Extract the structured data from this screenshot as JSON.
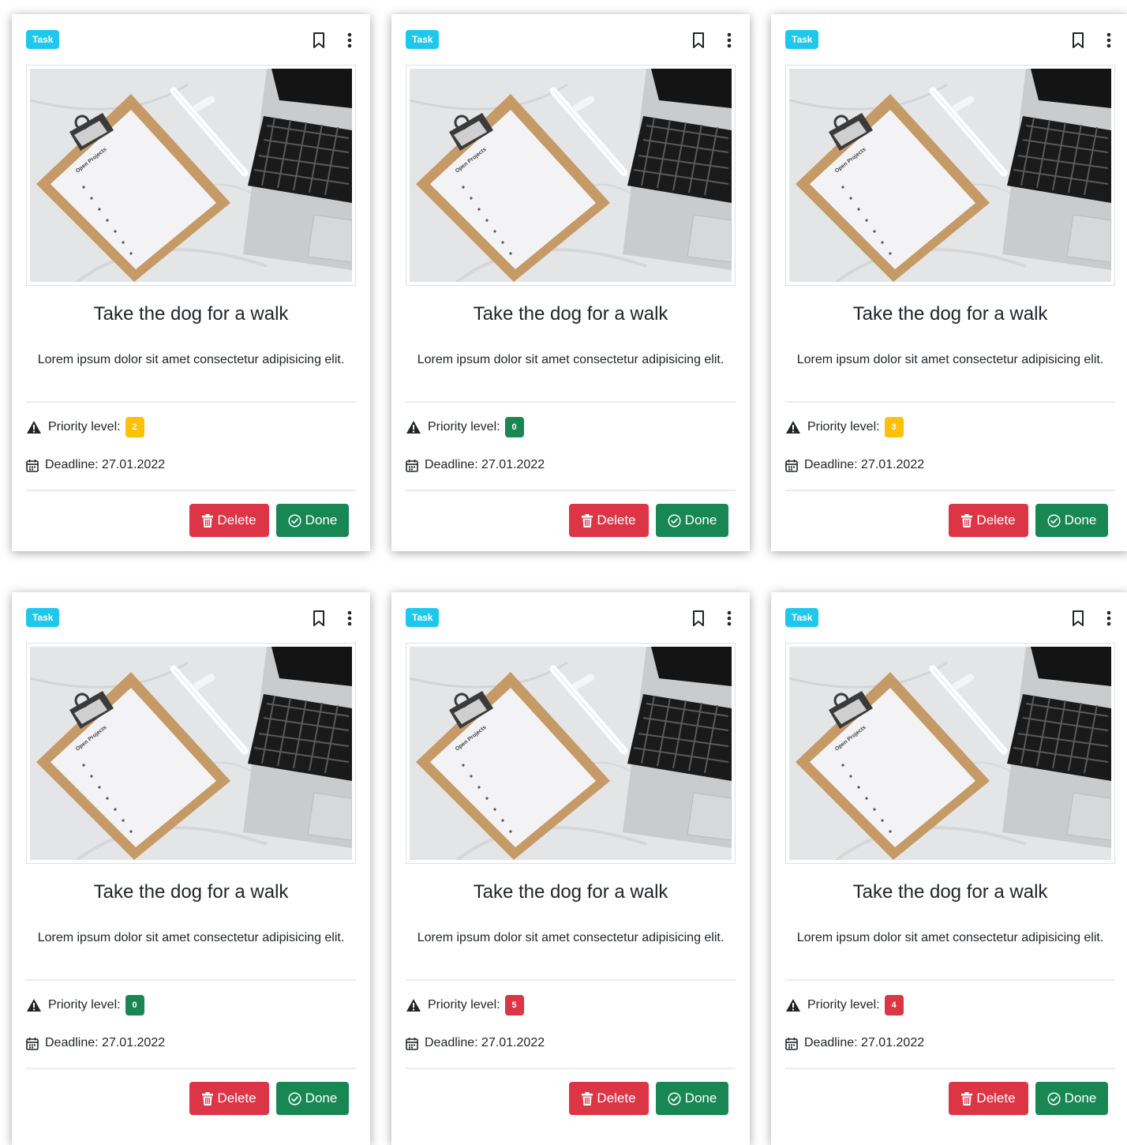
{
  "colors": {
    "task_badge": "#1ec8ec",
    "priority_warning": "#ffc107",
    "priority_success": "#198754",
    "priority_danger": "#dc3545",
    "delete_button": "#dc3545",
    "done_button": "#198754"
  },
  "cards": [
    {
      "badge": "Task",
      "title": "Take the dog for a walk",
      "description": "Lorem ipsum dolor sit amet consectetur adipisicing elit.",
      "priority_label": "Priority level:",
      "priority": "2",
      "priority_color": "#ffc107",
      "deadline": "Deadline: 27.01.2022",
      "delete_label": "Delete",
      "done_label": "Done",
      "image_text": "Open Projects"
    },
    {
      "badge": "Task",
      "title": "Take the dog for a walk",
      "description": "Lorem ipsum dolor sit amet consectetur adipisicing elit.",
      "priority_label": "Priority level:",
      "priority": "0",
      "priority_color": "#198754",
      "deadline": "Deadline: 27.01.2022",
      "delete_label": "Delete",
      "done_label": "Done",
      "image_text": "Open Projects"
    },
    {
      "badge": "Task",
      "title": "Take the dog for a walk",
      "description": "Lorem ipsum dolor sit amet consectetur adipisicing elit.",
      "priority_label": "Priority level:",
      "priority": "3",
      "priority_color": "#ffc107",
      "deadline": "Deadline: 27.01.2022",
      "delete_label": "Delete",
      "done_label": "Done",
      "image_text": "Open Projects"
    },
    {
      "badge": "Task",
      "title": "Take the dog for a walk",
      "description": "Lorem ipsum dolor sit amet consectetur adipisicing elit.",
      "priority_label": "Priority level:",
      "priority": "0",
      "priority_color": "#198754",
      "deadline": "Deadline: 27.01.2022",
      "delete_label": "Delete",
      "done_label": "Done",
      "image_text": "Open Projects"
    },
    {
      "badge": "Task",
      "title": "Take the dog for a walk",
      "description": "Lorem ipsum dolor sit amet consectetur adipisicing elit.",
      "priority_label": "Priority level:",
      "priority": "5",
      "priority_color": "#dc3545",
      "deadline": "Deadline: 27.01.2022",
      "delete_label": "Delete",
      "done_label": "Done",
      "image_text": "Open Projects"
    },
    {
      "badge": "Task",
      "title": "Take the dog for a walk",
      "description": "Lorem ipsum dolor sit amet consectetur adipisicing elit.",
      "priority_label": "Priority level:",
      "priority": "4",
      "priority_color": "#dc3545",
      "deadline": "Deadline: 27.01.2022",
      "delete_label": "Delete",
      "done_label": "Done",
      "image_text": "Open Projects"
    }
  ]
}
